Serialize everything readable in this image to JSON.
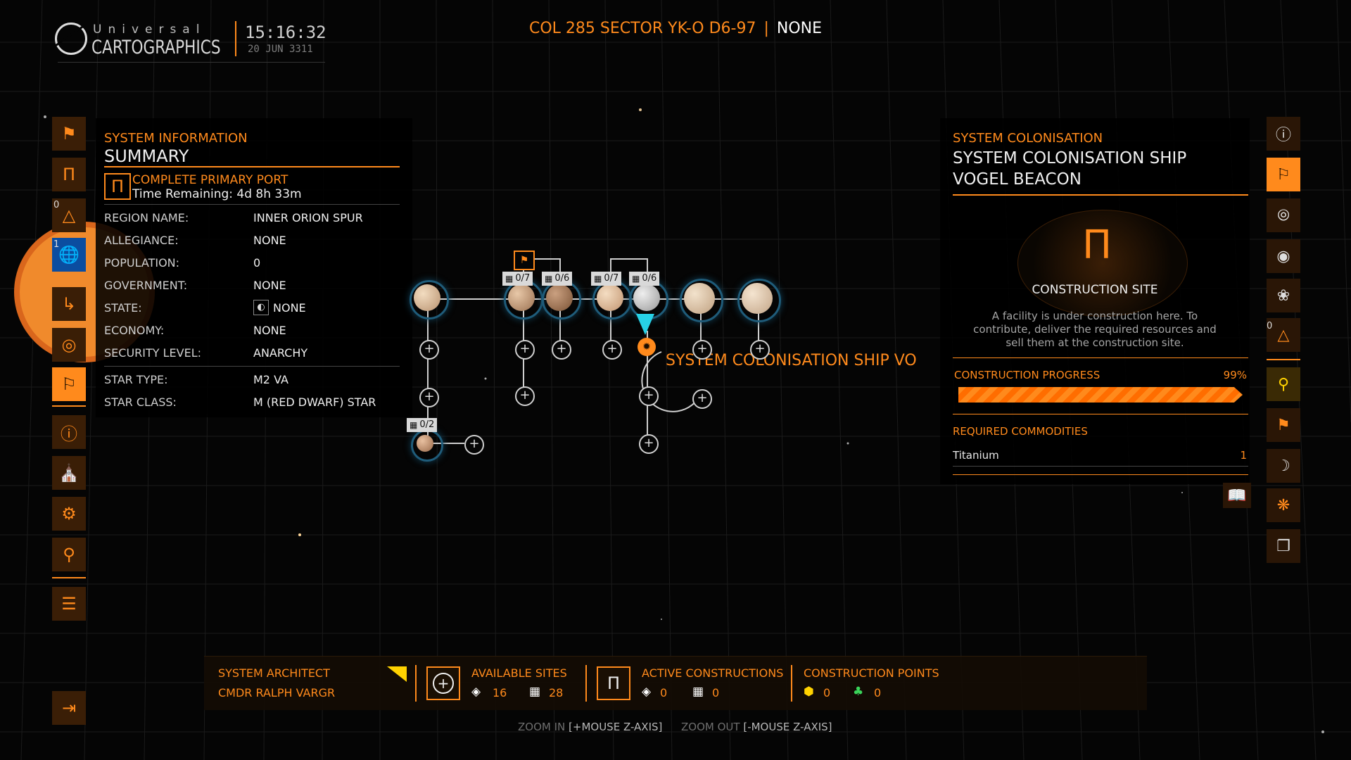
{
  "header": {
    "logo_top": "Universal",
    "logo_main": "CARTOGRAPHICS",
    "time": "15:16:32",
    "date": "20 JUN 3311",
    "system_name": "COL 285 SECTOR YK-O D6-97",
    "separator": "|",
    "system_faction": "NONE"
  },
  "left_nav": {
    "items": [
      {
        "icon": "bookmark-icon"
      },
      {
        "icon": "construction-icon"
      },
      {
        "icon": "planet-surface-icon",
        "count": "0"
      },
      {
        "icon": "globe-icon",
        "count": "1"
      },
      {
        "icon": "route-icon"
      },
      {
        "icon": "target-icon"
      },
      {
        "icon": "flag-station-icon"
      },
      {
        "icon": "info-icon"
      },
      {
        "icon": "government-icon"
      },
      {
        "icon": "settings-icon"
      },
      {
        "icon": "location-pin-icon"
      },
      {
        "icon": "list-icon"
      },
      {
        "icon": "exit-icon"
      }
    ]
  },
  "system_info": {
    "section": "SYSTEM INFORMATION",
    "title": "SUMMARY",
    "task_title": "COMPLETE PRIMARY PORT",
    "task_time": "Time Remaining: 4d 8h 33m",
    "rows": [
      {
        "label": "REGION NAME:",
        "value": "INNER ORION SPUR"
      },
      {
        "label": "ALLEGIANCE:",
        "value": "NONE"
      },
      {
        "label": "POPULATION:",
        "value": "0"
      },
      {
        "label": "GOVERNMENT:",
        "value": "NONE"
      },
      {
        "label": "STATE:",
        "value": "NONE"
      },
      {
        "label": "ECONOMY:",
        "value": "NONE"
      },
      {
        "label": "SECURITY LEVEL:",
        "value": "ANARCHY"
      },
      {
        "label": "STAR TYPE:",
        "value": "M2 VA"
      },
      {
        "label": "STAR CLASS:",
        "value": "M (RED DWARF) STAR"
      }
    ]
  },
  "map": {
    "badges": [
      "0/7",
      "0/6",
      "0/7",
      "0/6",
      "0/2"
    ],
    "selected_label": "SYSTEM COLONISATION SHIP VO"
  },
  "colonisation": {
    "section": "SYSTEM COLONISATION",
    "title_line1": "SYSTEM COLONISATION SHIP",
    "title_line2": "VOGEL BEACON",
    "site_name": "CONSTRUCTION SITE",
    "description": "A facility is under construction here. To contribute, deliver the required resources and sell them at the construction site.",
    "progress_label": "CONSTRUCTION PROGRESS",
    "progress_text": "99%",
    "progress_value": 0.99,
    "required_label": "REQUIRED COMMODITIES",
    "commodities": [
      {
        "name": "Titanium",
        "qty": "1"
      }
    ]
  },
  "right_nav": {
    "items": [
      {
        "icon": "info-eye-icon"
      },
      {
        "icon": "flag-station-icon"
      },
      {
        "icon": "scan-icon"
      },
      {
        "icon": "target-circle-icon"
      },
      {
        "icon": "dna-icon"
      },
      {
        "icon": "planet-surface-icon",
        "count": "0"
      },
      {
        "icon": "location-pin-icon"
      },
      {
        "icon": "bookmark-icon"
      },
      {
        "icon": "moon-icon"
      },
      {
        "icon": "network-icon"
      },
      {
        "icon": "layers-icon"
      }
    ]
  },
  "bottom_bar": {
    "architect_label": "SYSTEM ARCHITECT",
    "architect_name": "CMDR RALPH VARGR",
    "available_label": "AVAILABLE SITES",
    "available_orbital": "16",
    "available_surface": "28",
    "active_label": "ACTIVE CONSTRUCTIONS",
    "active_orbital": "0",
    "active_surface": "0",
    "points_label": "CONSTRUCTION POINTS",
    "points_tier2": "0",
    "points_tier3": "0"
  },
  "hints": {
    "zoom_in_label": "ZOOM IN",
    "zoom_in_key": "[+MOUSE Z-AXIS]",
    "zoom_out_label": "ZOOM OUT",
    "zoom_out_key": "[-MOUSE Z-AXIS]"
  },
  "colors": {
    "accent": "#ff8a1c",
    "ring": "#1f5c7a",
    "selection": "#27d1e6"
  }
}
